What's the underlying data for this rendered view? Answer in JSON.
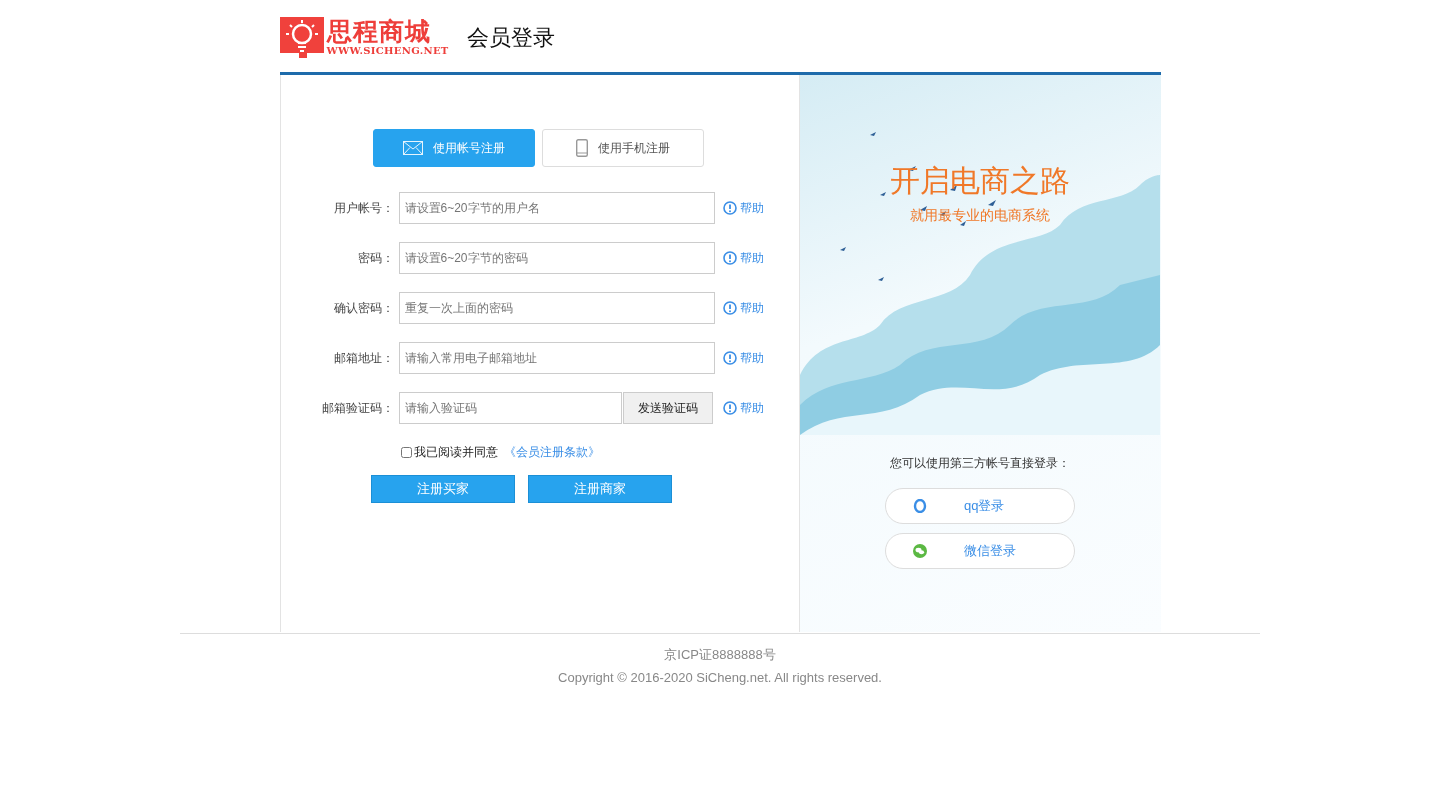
{
  "header": {
    "logo": {
      "name": "思程商城",
      "url": "WWW.SICHENG.NET"
    },
    "title": "会员登录"
  },
  "tabs": [
    {
      "label": "使用帐号注册",
      "kind": "email",
      "selected": true
    },
    {
      "label": "使用手机注册",
      "kind": "phone",
      "selected": false
    }
  ],
  "fields": [
    {
      "label": "用户帐号：",
      "placeholder": "请设置6~20字节的用户名",
      "help": "帮助"
    },
    {
      "label": "密码：",
      "placeholder": "请设置6~20字节的密码",
      "help": "帮助"
    },
    {
      "label": "确认密码：",
      "placeholder": "重复一次上面的密码",
      "help": "帮助"
    },
    {
      "label": "邮箱地址：",
      "placeholder": "请输入常用电子邮箱地址",
      "help": "帮助"
    },
    {
      "label": "邮箱验证码：",
      "placeholder": "请输入验证码",
      "action": "发送验证码",
      "help": "帮助"
    }
  ],
  "agreement": {
    "checked": false,
    "text": "我已阅读并同意",
    "link": "《会员注册条款》"
  },
  "buttons": [
    "注册买家",
    "注册商家"
  ],
  "promo": {
    "headline": "开启电商之路",
    "subtitle": "就用最专业的电商系统",
    "third_party_prompt": "您可以使用第三方帐号直接登录：",
    "logins": [
      {
        "kind": "qq",
        "label": "qq登录"
      },
      {
        "kind": "wechat",
        "label": "微信登录"
      }
    ]
  },
  "footer": {
    "icp": "京ICP证8888888号",
    "copyright": "Copyright © 2016-2020 SiCheng.net. All rights reserved."
  }
}
